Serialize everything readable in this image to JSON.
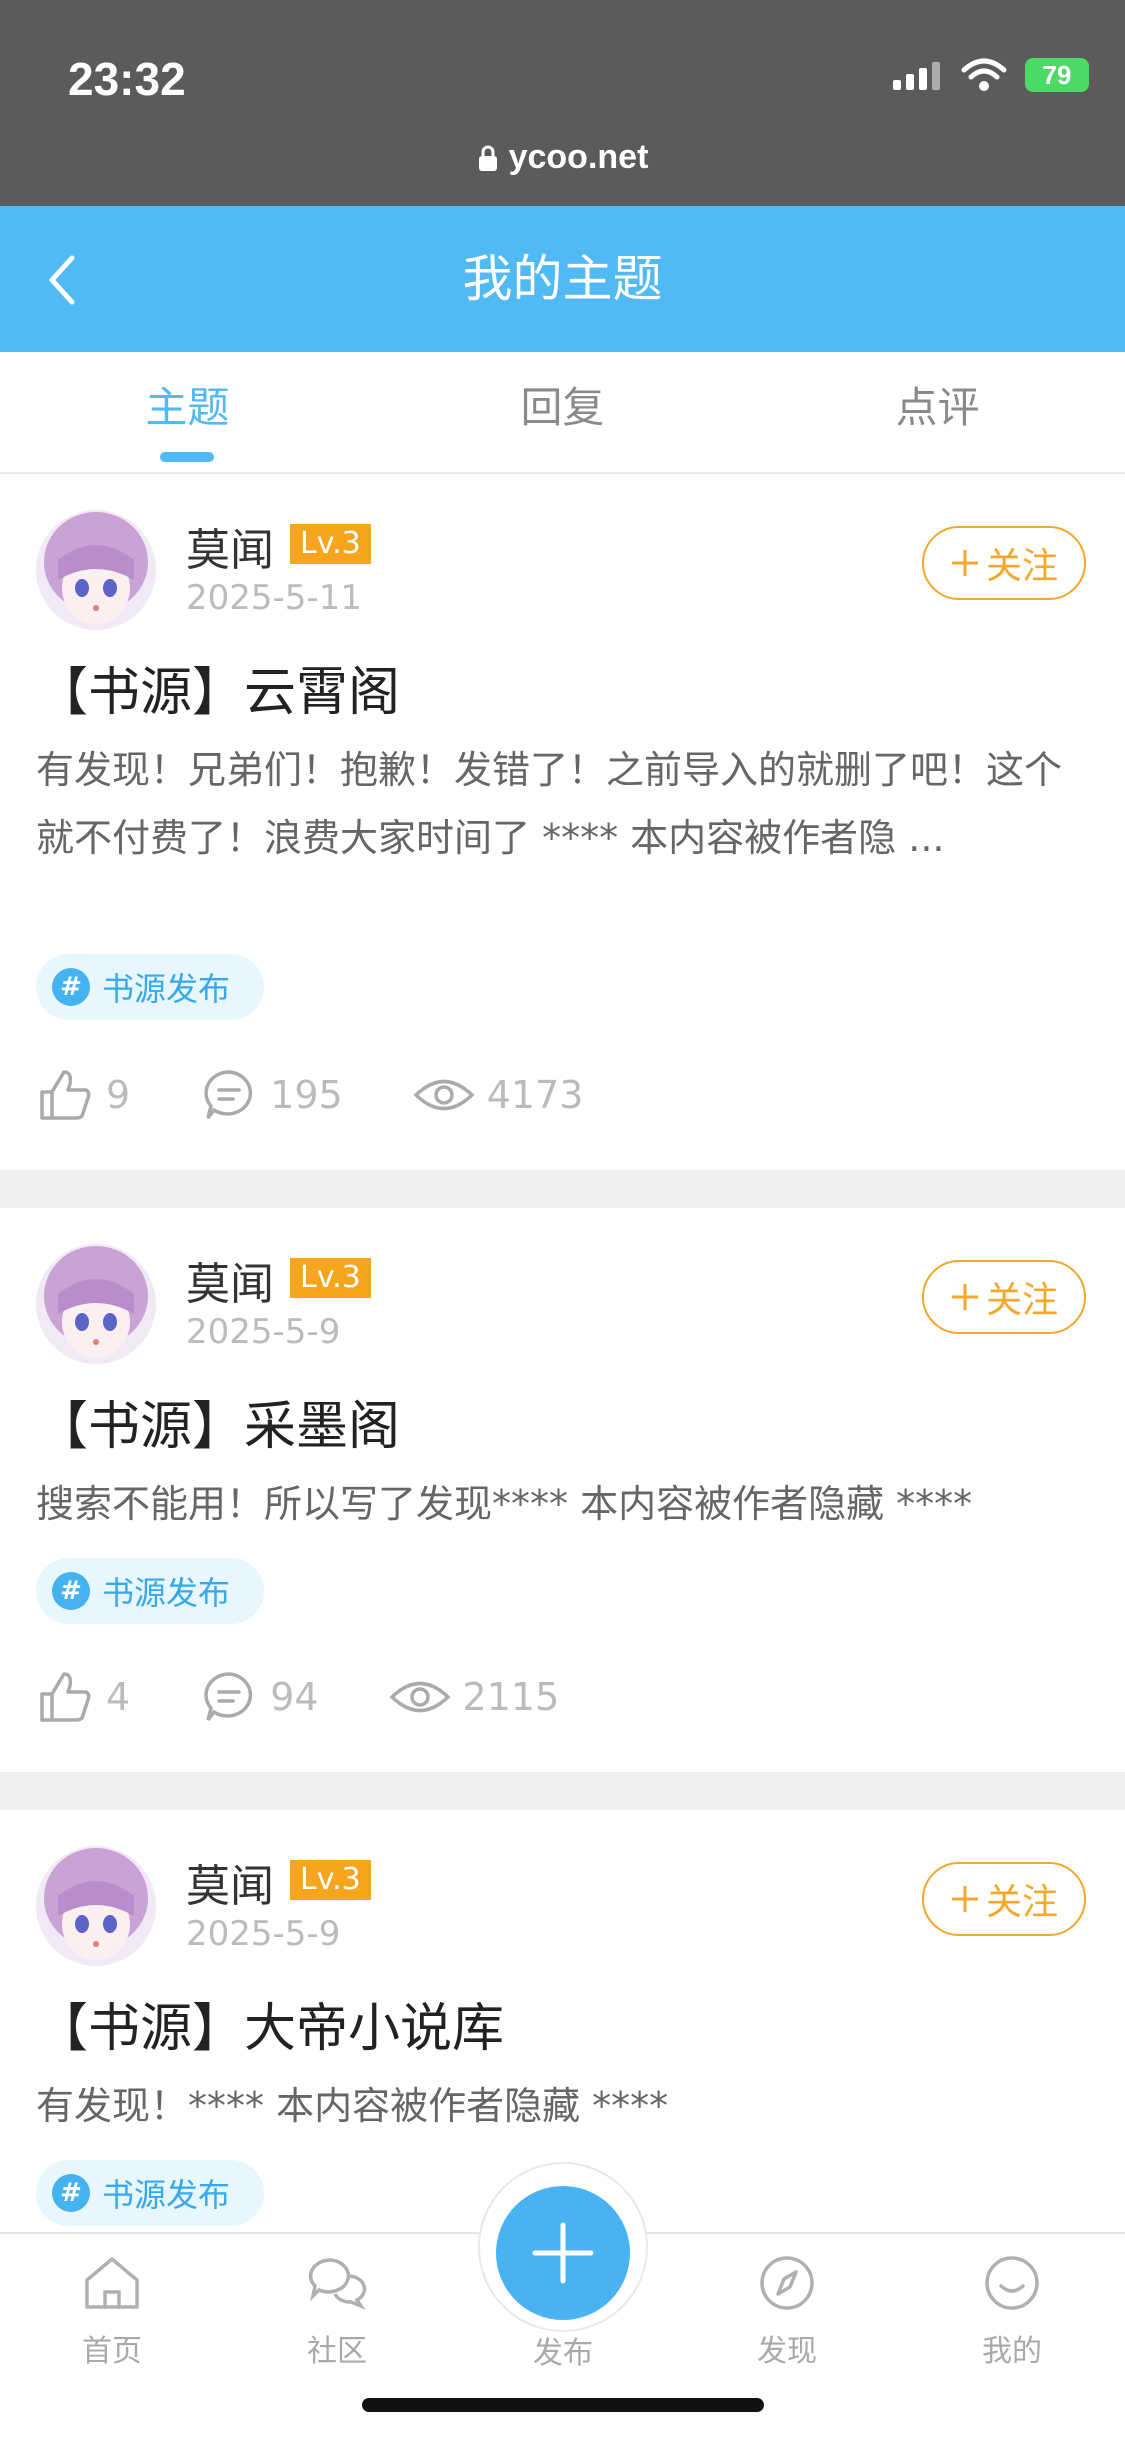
{
  "status_bar": {
    "time": "23:32",
    "battery": "79",
    "url": "ycoo.net"
  },
  "header": {
    "title": "我的主题"
  },
  "tabs": [
    {
      "label": "主题",
      "active": true
    },
    {
      "label": "回复",
      "active": false
    },
    {
      "label": "点评",
      "active": false
    }
  ],
  "posts": [
    {
      "author": "莫闻",
      "level": "Lv.3",
      "date": "2025-5-11",
      "follow_label": "关注",
      "title": "【书源】云霄阁",
      "excerpt": "有发现！兄弟们！抱歉！发错了！之前导入的就删了吧！这个就不付费了！浪费大家时间了 **** 本内容被作者隐 ...",
      "tag": "书源发布",
      "likes": "9",
      "comments": "195",
      "views": "4173"
    },
    {
      "author": "莫闻",
      "level": "Lv.3",
      "date": "2025-5-9",
      "follow_label": "关注",
      "title": "【书源】采墨阁",
      "excerpt": "搜索不能用！所以写了发现**** 本内容被作者隐藏 ****",
      "tag": "书源发布",
      "likes": "4",
      "comments": "94",
      "views": "2115"
    },
    {
      "author": "莫闻",
      "level": "Lv.3",
      "date": "2025-5-9",
      "follow_label": "关注",
      "title": "【书源】大帝小说库",
      "excerpt": "有发现！**** 本内容被作者隐藏 ****",
      "tag": "书源发布"
    }
  ],
  "bottom_nav": [
    {
      "label": "首页",
      "icon": "home-icon"
    },
    {
      "label": "社区",
      "icon": "community-icon"
    },
    {
      "label": "发布",
      "icon": "plus-icon"
    },
    {
      "label": "发现",
      "icon": "compass-icon"
    },
    {
      "label": "我的",
      "icon": "smile-icon"
    }
  ],
  "colors": {
    "accent": "#51b9f4",
    "follow": "#f4a72b",
    "level_badge": "#f7a51c",
    "battery": "#4cd964"
  }
}
